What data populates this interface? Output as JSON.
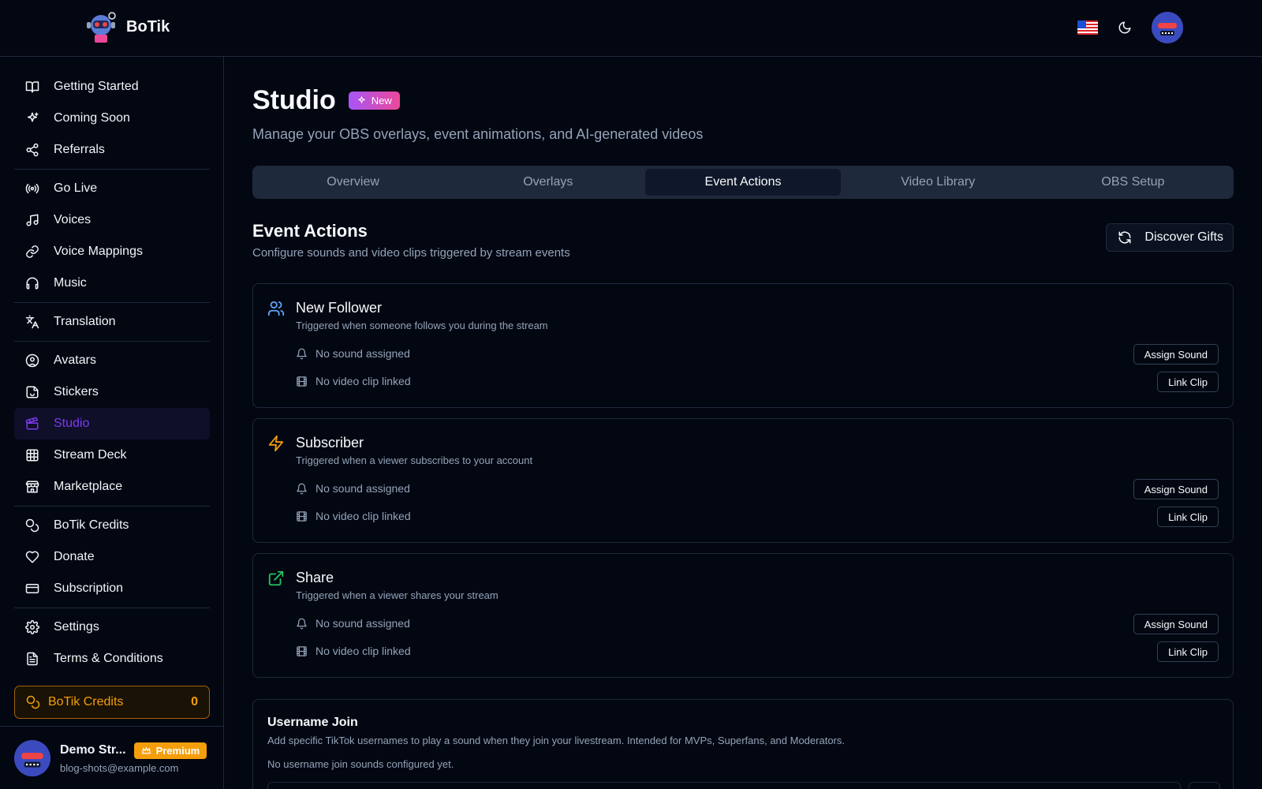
{
  "header": {
    "brand": "BoTik",
    "language_icon": "us-flag-icon",
    "theme_icon": "moon-icon"
  },
  "sidebar": {
    "groups": [
      [
        {
          "label": "Getting Started",
          "icon": "book-open-icon"
        },
        {
          "label": "Coming Soon",
          "icon": "sparkles-icon"
        },
        {
          "label": "Referrals",
          "icon": "share-icon"
        }
      ],
      [
        {
          "label": "Go Live",
          "icon": "broadcast-icon"
        },
        {
          "label": "Voices",
          "icon": "music-note-icon"
        },
        {
          "label": "Voice Mappings",
          "icon": "link-icon"
        },
        {
          "label": "Music",
          "icon": "headphones-icon"
        }
      ],
      [
        {
          "label": "Translation",
          "icon": "languages-icon"
        }
      ],
      [
        {
          "label": "Avatars",
          "icon": "user-circle-icon"
        },
        {
          "label": "Stickers",
          "icon": "sticker-icon"
        },
        {
          "label": "Studio",
          "icon": "clapperboard-icon",
          "active": true
        },
        {
          "label": "Stream Deck",
          "icon": "grid-icon"
        },
        {
          "label": "Marketplace",
          "icon": "store-icon"
        }
      ],
      [
        {
          "label": "BoTik Credits",
          "icon": "coins-icon"
        },
        {
          "label": "Donate",
          "icon": "heart-icon"
        },
        {
          "label": "Subscription",
          "icon": "credit-card-icon"
        }
      ],
      [
        {
          "label": "Settings",
          "icon": "gear-icon"
        },
        {
          "label": "Terms & Conditions",
          "icon": "document-icon"
        }
      ]
    ],
    "credits": {
      "label": "BoTik Credits",
      "value": "0"
    },
    "user": {
      "name": "Demo Str...",
      "badge": "Premium",
      "email": "blog-shots@example.com"
    }
  },
  "main": {
    "title": "Studio",
    "badge": "New",
    "subtitle": "Manage your OBS overlays, event animations, and AI-generated videos",
    "tabs": [
      {
        "label": "Overview"
      },
      {
        "label": "Overlays"
      },
      {
        "label": "Event Actions",
        "active": true
      },
      {
        "label": "Video Library"
      },
      {
        "label": "OBS Setup"
      }
    ],
    "section_title": "Event Actions",
    "section_subtitle": "Configure sounds and video clips triggered by stream events",
    "discover_label": "Discover Gifts",
    "events": [
      {
        "title": "New Follower",
        "description": "Triggered when someone follows you during the stream",
        "sound": "No sound assigned",
        "clip": "No video clip linked",
        "sound_btn": "Assign Sound",
        "clip_btn": "Link Clip",
        "icon": "users-icon",
        "color": "#60a5fa"
      },
      {
        "title": "Subscriber",
        "description": "Triggered when a viewer subscribes to your account",
        "sound": "No sound assigned",
        "clip": "No video clip linked",
        "sound_btn": "Assign Sound",
        "clip_btn": "Link Clip",
        "icon": "lightning-icon",
        "color": "#f59e0b"
      },
      {
        "title": "Share",
        "description": "Triggered when a viewer shares your stream",
        "sound": "No sound assigned",
        "clip": "No video clip linked",
        "sound_btn": "Assign Sound",
        "clip_btn": "Link Clip",
        "icon": "external-link-icon",
        "color": "#22c55e"
      }
    ],
    "username_join": {
      "title": "Username Join",
      "description": "Add specific TikTok usernames to play a sound when they join your livestream. Intended for MVPs, Superfans, and Moderators.",
      "empty": "No username join sounds configured yet."
    }
  }
}
